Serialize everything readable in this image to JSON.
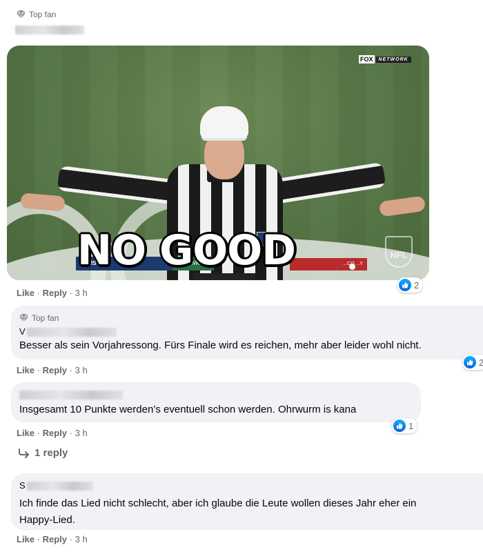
{
  "comment1": {
    "badge": "Top fan",
    "actions": {
      "like": "Like",
      "sep": "·",
      "reply": "Reply",
      "time": "3 h"
    },
    "reaction_count": "2"
  },
  "gif": {
    "overlay_text": "NO GOOD",
    "network_logo": "FOX",
    "network_sub": "NETWORK",
    "team_left": "RAMS",
    "team_mid": "HAWKS",
    "team_right": "...CO ...Y",
    "score_mid": "2",
    "league": "NFL"
  },
  "comment2": {
    "badge": "Top fan",
    "name_initial": "V",
    "text": "Besser als sein Vorjahressong. Fürs Finale wird es reichen, mehr aber leider wohl nicht.",
    "actions": {
      "like": "Like",
      "sep": "·",
      "reply": "Reply",
      "time": "3 h"
    },
    "reaction_count": "2"
  },
  "comment3": {
    "text": "Insgesamt 10 Punkte werden’s eventuell schon werden. Ohrwurm is kana",
    "actions": {
      "like": "Like",
      "sep": "·",
      "reply": "Reply",
      "time": "3 h"
    },
    "reaction_count": "1",
    "replies_link": "1 reply"
  },
  "comment4": {
    "name_initial": "S",
    "text_line1": "Ich finde das Lied nicht schlecht, aber ich glaube die Leute wollen dieses Jahr eher ein",
    "text_line2": "Happy-Lied.",
    "actions": {
      "like": "Like",
      "sep": "·",
      "reply": "Reply",
      "time": "3 h"
    }
  },
  "colors": {
    "accent": "#1877f2",
    "secondary_text": "#65676b",
    "bubble_bg": "#f0f2f5"
  },
  "icons": [
    "diamond-icon",
    "like-icon",
    "reply-arrow-icon"
  ]
}
